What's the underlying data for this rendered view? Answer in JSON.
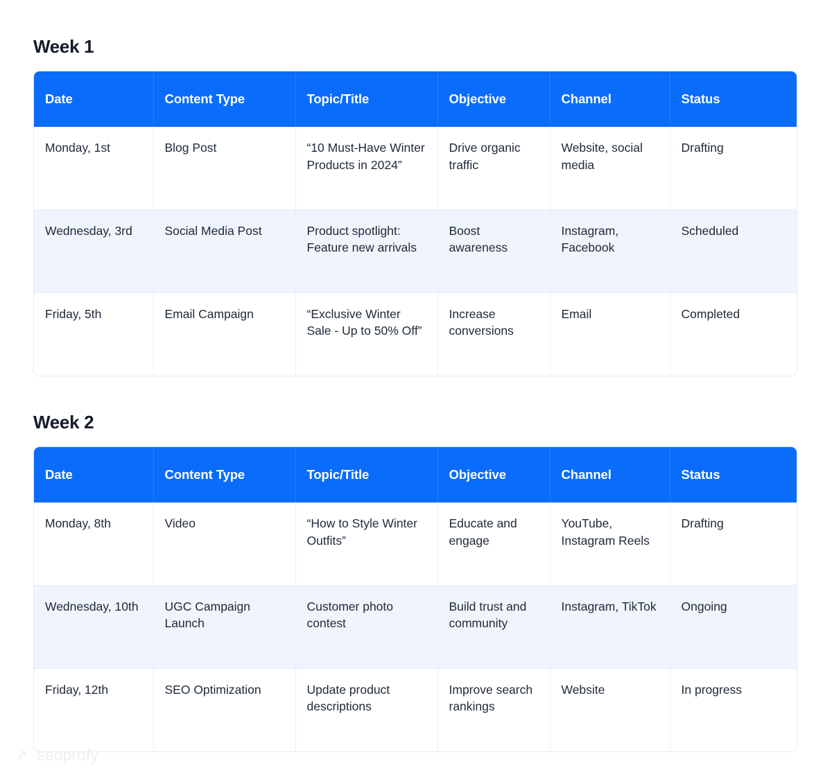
{
  "columns": [
    "Date",
    "Content Type",
    "Topic/Title",
    "Objective",
    "Channel",
    "Status"
  ],
  "sections": [
    {
      "title": "Week 1",
      "rows": [
        {
          "date": "Monday, 1st",
          "content_type": "Blog Post",
          "topic": "“10 Must-Have Winter Products in 2024”",
          "objective": "Drive organic traffic",
          "channel": "Website, social media",
          "status": "Drafting"
        },
        {
          "date": "Wednesday, 3rd",
          "content_type": "Social Media Post",
          "topic": "Product spotlight: Feature new arrivals",
          "objective": "Boost awareness",
          "channel": "Instagram, Facebook",
          "status": "Scheduled"
        },
        {
          "date": "Friday, 5th",
          "content_type": "Email Campaign",
          "topic": "“Exclusive Winter Sale - Up to 50% Off”",
          "objective": "Increase conversions",
          "channel": "Email",
          "status": "Completed"
        }
      ]
    },
    {
      "title": "Week 2",
      "rows": [
        {
          "date": "Monday, 8th",
          "content_type": "Video",
          "topic": "“How to Style Winter Outfits”",
          "objective": "Educate and engage",
          "channel": "YouTube, Instagram Reels",
          "status": "Drafting"
        },
        {
          "date": "Wednesday, 10th",
          "content_type": "UGC Campaign Launch",
          "topic": "Customer photo contest",
          "objective": "Build trust and community",
          "channel": "Instagram, TikTok",
          "status": "Ongoing"
        },
        {
          "date": "Friday, 12th",
          "content_type": "SEO Optimization",
          "topic": "Update product descriptions",
          "objective": "Improve search rankings",
          "channel": "Website",
          "status": "In progress"
        }
      ]
    }
  ],
  "footer": {
    "logo_text": "seoprofy",
    "logo_icon": "arrow-up-right-icon",
    "logo_glyph": "↗"
  },
  "colors": {
    "header_blue": "#0a6cfb",
    "alt_row": "#eff4fe",
    "border": "#e8eff9",
    "text": "#1f2937",
    "title": "#141b29",
    "logo": "#eceff3"
  }
}
